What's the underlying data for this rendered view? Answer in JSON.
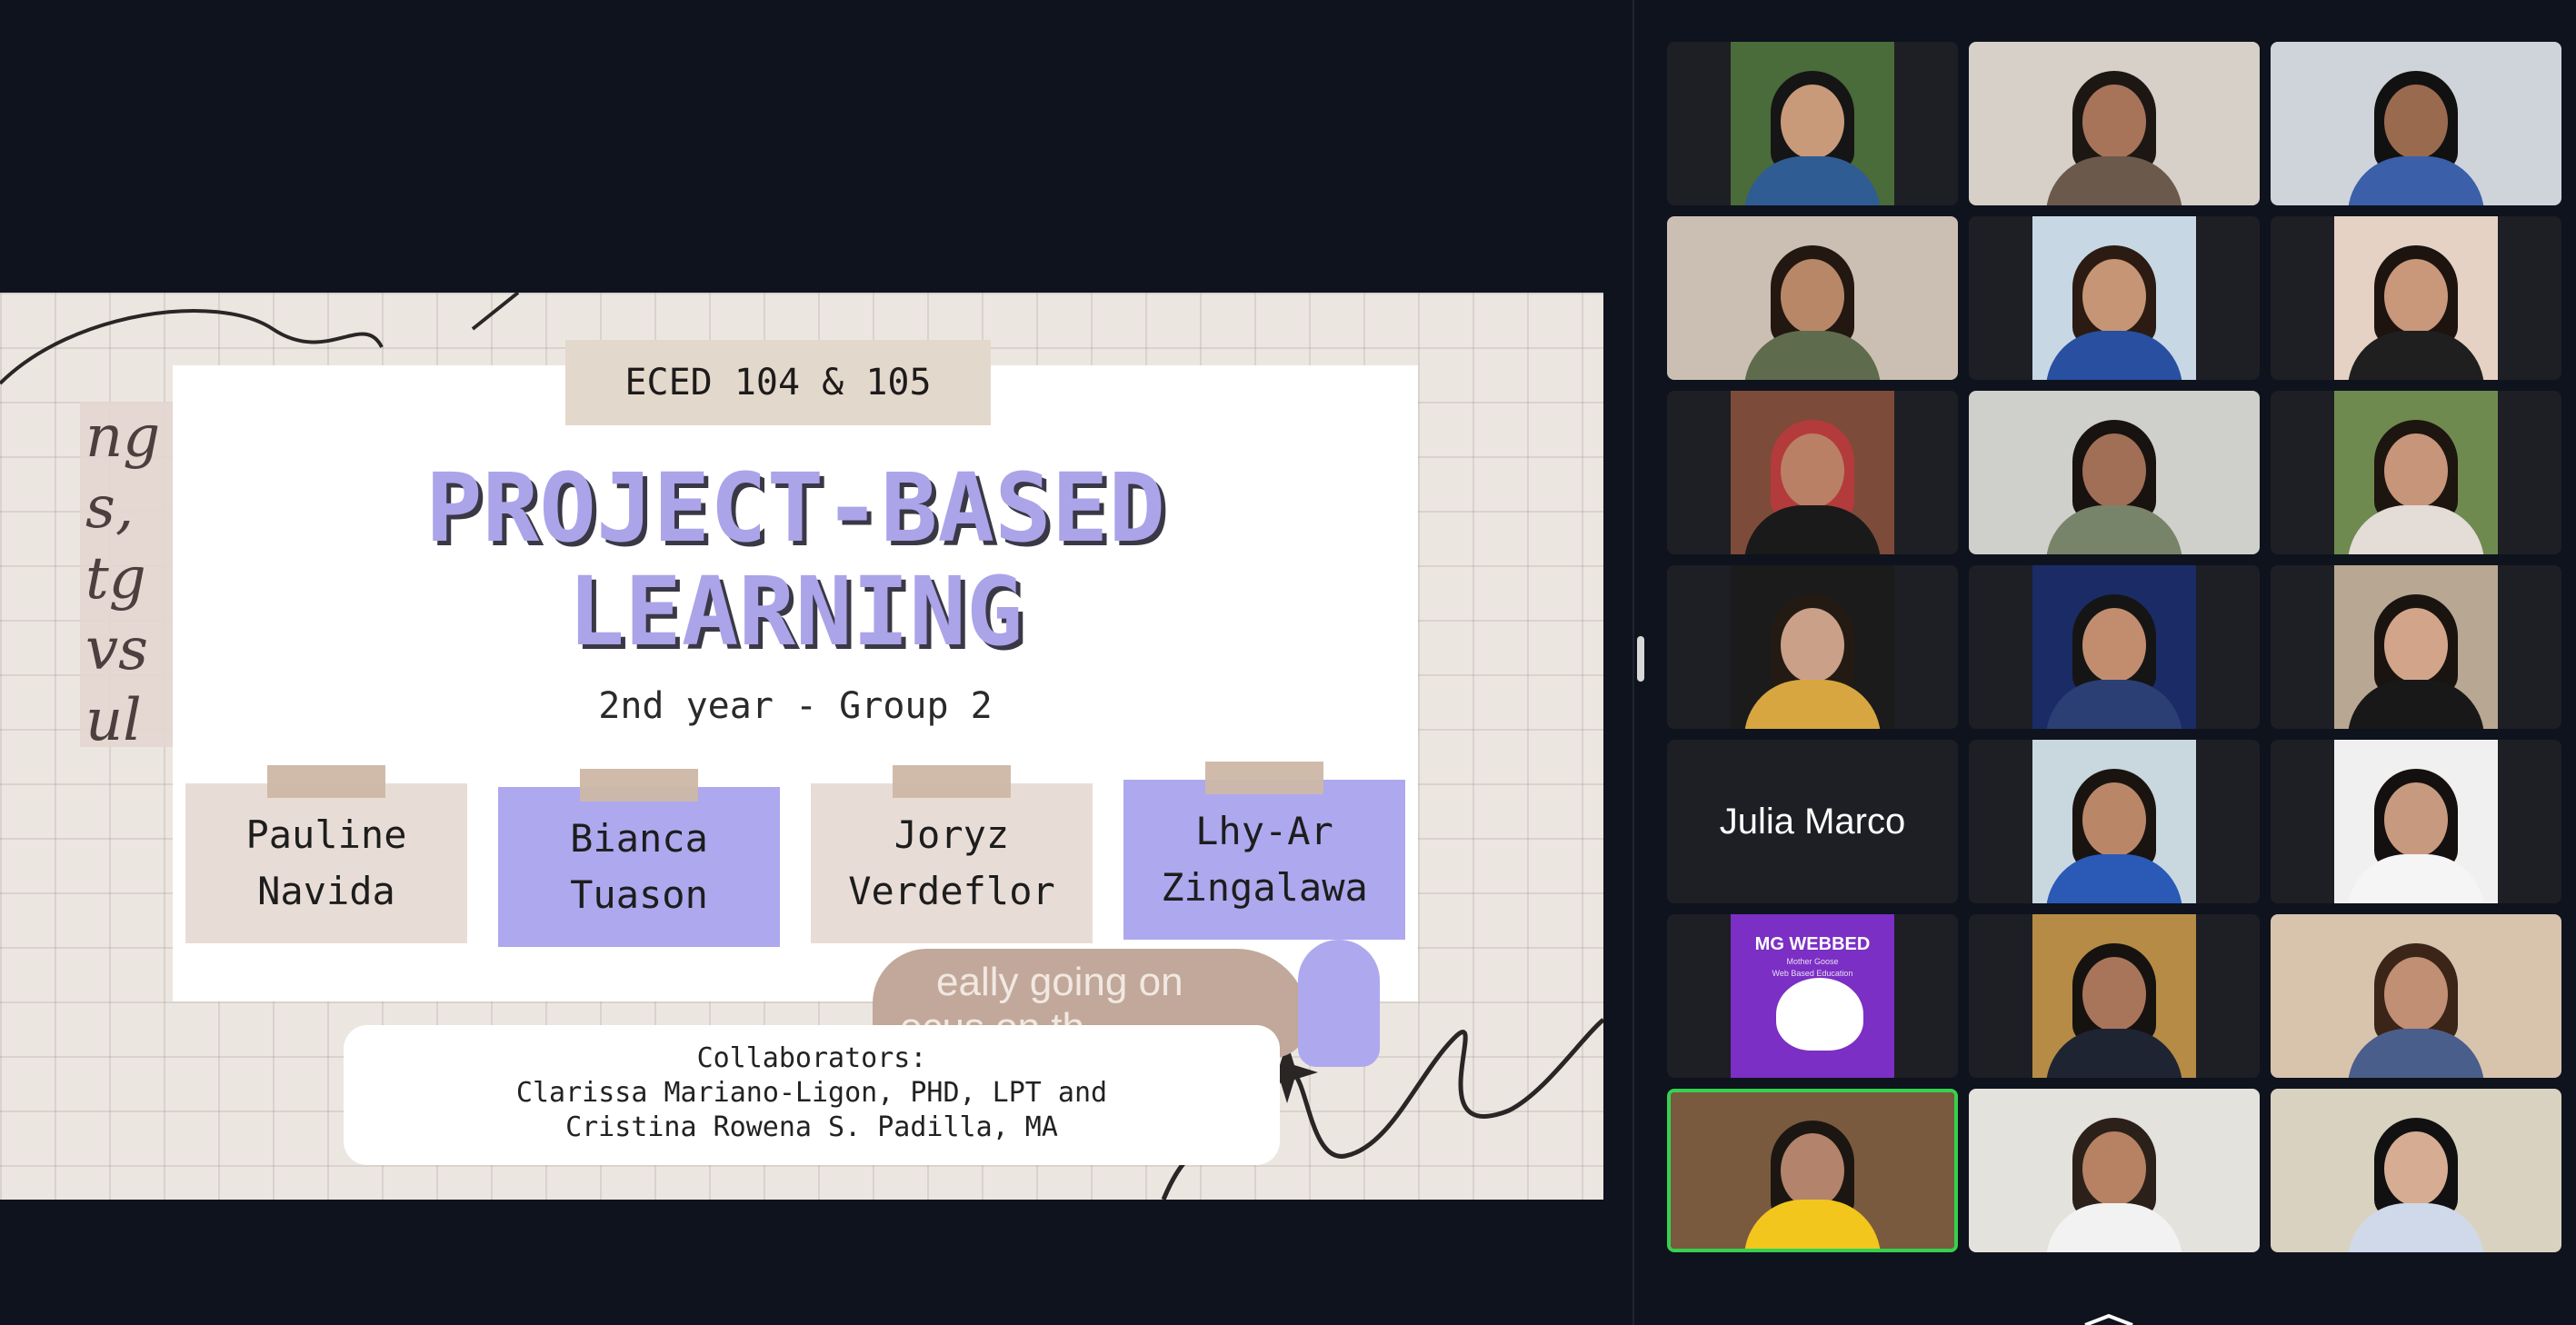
{
  "slide": {
    "course": "ECED 104 & 105",
    "title_line1": "PROJECT-BASED",
    "title_line2": "LEARNING",
    "subtitle": "2nd year - Group 2",
    "members": [
      {
        "first": "Pauline",
        "last": "Navida",
        "style": "beige"
      },
      {
        "first": "Bianca",
        "last": "Tuason",
        "style": "purple"
      },
      {
        "first": "Joryz",
        "last": "Verdeflor",
        "style": "beige"
      },
      {
        "first": "Lhy-Ar",
        "last": "Zingalawa",
        "style": "purple"
      }
    ],
    "scrap_text": "eally going on",
    "scrap_text2": "ocus on th",
    "script_scrap_lines": [
      "ng",
      "s,",
      "tg",
      "vs",
      "ul"
    ],
    "collaborators_heading": "Collaborators:",
    "collaborators_line1": "Clarissa Mariano-Ligon, PHD, LPT and",
    "collaborators_line2": "Cristina Rowena S. Padilla, MA"
  },
  "gallery": {
    "tiles": [
      {
        "type": "video",
        "fit": "narrow",
        "bg": "#4a6b3a",
        "skin": "#c89a7a",
        "hair": "#151515",
        "shirt": "#2f5c93"
      },
      {
        "type": "video",
        "fit": "full",
        "bg": "#d6d0c8",
        "skin": "#a7745a",
        "hair": "#1d1714",
        "shirt": "#6b5a4c"
      },
      {
        "type": "video",
        "fit": "full",
        "bg": "#cfd4db",
        "skin": "#9a6a4e",
        "hair": "#111111",
        "shirt": "#3b5fa8"
      },
      {
        "type": "video",
        "fit": "full",
        "bg": "#cbbfb3",
        "skin": "#b88768",
        "hair": "#221711",
        "shirt": "#5f6b4d"
      },
      {
        "type": "video",
        "fit": "narrow",
        "bg": "#c7d7e4",
        "skin": "#c69575",
        "hair": "#2b1b12",
        "shirt": "#284fa0"
      },
      {
        "type": "video",
        "fit": "narrow",
        "bg": "#e6d2c5",
        "skin": "#c9977a",
        "hair": "#1d1410",
        "shirt": "#1f1f1f"
      },
      {
        "type": "video",
        "fit": "narrow",
        "bg": "#7d4b3a",
        "skin": "#b98065",
        "hair": "#b33b3b",
        "shirt": "#1a1a1a"
      },
      {
        "type": "video",
        "fit": "full",
        "bg": "#cfd0cb",
        "skin": "#a06f55",
        "hair": "#181210",
        "shirt": "#77846a"
      },
      {
        "type": "video",
        "fit": "narrow",
        "bg": "#6e8a4f",
        "skin": "#c7957a",
        "hair": "#1d1510",
        "shirt": "#e4dcd6"
      },
      {
        "type": "video",
        "fit": "narrow",
        "bg": "#1b1b1b",
        "skin": "#caa089",
        "hair": "#241a14",
        "shirt": "#d7a640"
      },
      {
        "type": "video",
        "fit": "narrow",
        "bg": "#1b2b66",
        "skin": "#c28d6f",
        "hair": "#151515",
        "shirt": "#2c3f74"
      },
      {
        "type": "video",
        "fit": "narrow",
        "bg": "#b8a792",
        "skin": "#d2a58a",
        "hair": "#1a1410",
        "shirt": "#181818"
      },
      {
        "type": "name",
        "name": "Julia Marco"
      },
      {
        "type": "video",
        "fit": "narrow",
        "bg": "#c9d7df",
        "skin": "#b98768",
        "hair": "#1a1411",
        "shirt": "#2a5ab6"
      },
      {
        "type": "video",
        "fit": "narrow",
        "bg": "#f0f0f0",
        "skin": "#c79a7f",
        "hair": "#141010",
        "shirt": "#f5f5f5"
      },
      {
        "type": "logo",
        "logo_title": "MG WEBBED",
        "logo_sub_line1": "Mother Goose",
        "logo_sub_line2": "Web Based Education"
      },
      {
        "type": "video",
        "fit": "narrow",
        "bg": "#b58b45",
        "skin": "#a9755a",
        "hair": "#161210",
        "shirt": "#1f2433"
      },
      {
        "type": "video",
        "fit": "full",
        "bg": "#d8c3ad",
        "skin": "#c08f74",
        "hair": "#3b2418",
        "shirt": "#4a5e8c"
      },
      {
        "type": "video",
        "fit": "full",
        "bg": "#7a5a3e",
        "skin": "#b3836b",
        "hair": "#1b1612",
        "shirt": "#f2c61d",
        "active": true
      },
      {
        "type": "video",
        "fit": "full",
        "bg": "#e4e2dc",
        "skin": "#b68263",
        "hair": "#2c211a",
        "shirt": "#f2f2f2"
      },
      {
        "type": "video",
        "fit": "full",
        "bg": "#d9d2c0",
        "skin": "#d6ad92",
        "hair": "#111111",
        "shirt": "#cfd9ea"
      }
    ]
  }
}
